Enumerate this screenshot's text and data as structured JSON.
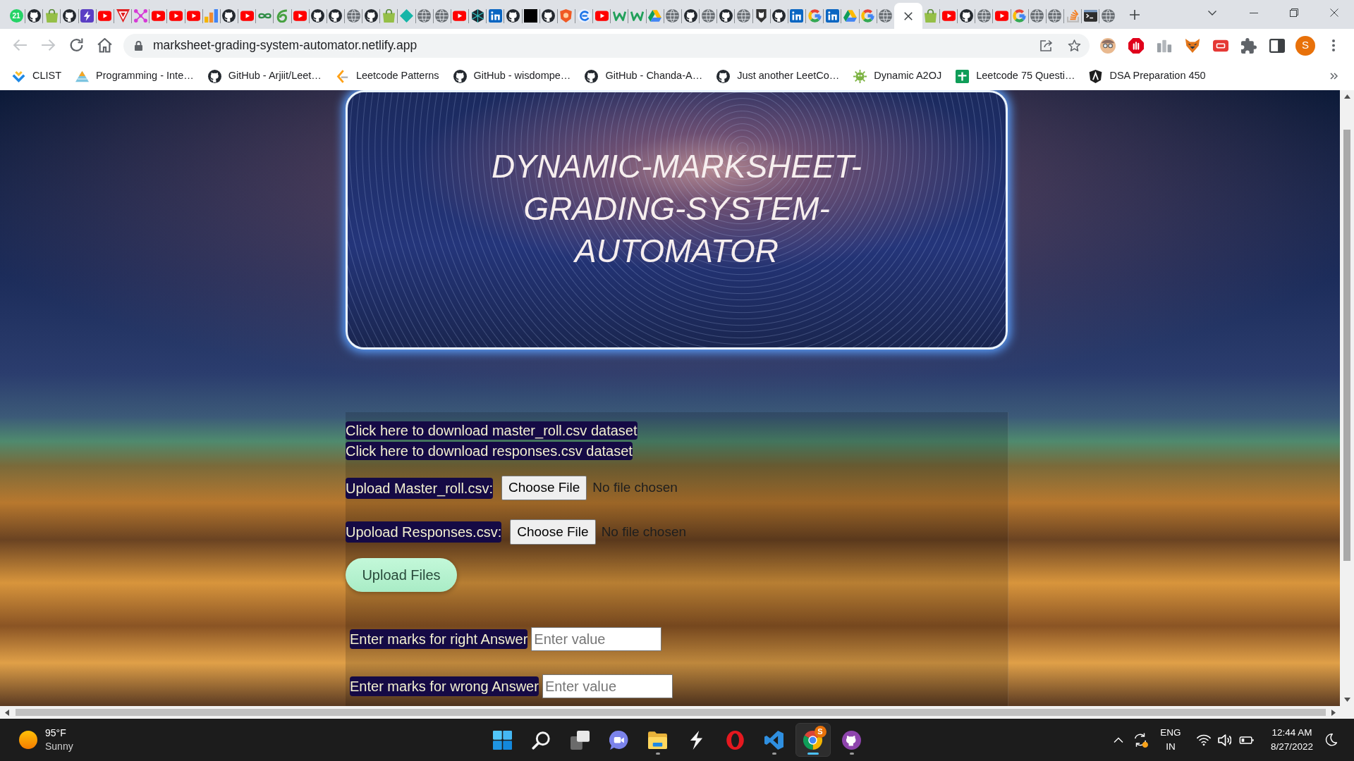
{
  "browser": {
    "tabs": [
      {
        "kind": "chat",
        "badge": "21",
        "selected": false
      },
      {
        "kind": "octocat",
        "selected": false
      },
      {
        "kind": "bag",
        "selected": false
      },
      {
        "kind": "octocat",
        "selected": false
      },
      {
        "kind": "bolt",
        "selected": false
      },
      {
        "kind": "play",
        "selected": false
      },
      {
        "kind": "pennant",
        "selected": false
      },
      {
        "kind": "nodes",
        "selected": false
      },
      {
        "kind": "play",
        "selected": false
      },
      {
        "kind": "play",
        "selected": false
      },
      {
        "kind": "play",
        "selected": false
      },
      {
        "kind": "bars",
        "selected": false
      },
      {
        "kind": "octocat",
        "selected": false
      },
      {
        "kind": "play",
        "selected": false
      },
      {
        "kind": "loops",
        "selected": false
      },
      {
        "kind": "leaf",
        "selected": false
      },
      {
        "kind": "play",
        "selected": false
      },
      {
        "kind": "octocat",
        "selected": false
      },
      {
        "kind": "octocat",
        "selected": false
      },
      {
        "kind": "globe",
        "selected": false
      },
      {
        "kind": "octocat",
        "selected": false
      },
      {
        "kind": "bag",
        "selected": false
      },
      {
        "kind": "diamond",
        "selected": false
      },
      {
        "kind": "globe",
        "selected": false
      },
      {
        "kind": "globe",
        "selected": false
      },
      {
        "kind": "play",
        "selected": false
      },
      {
        "kind": "crystal",
        "selected": false
      },
      {
        "kind": "in-square",
        "selected": false
      },
      {
        "kind": "octocat",
        "selected": false
      },
      {
        "kind": "square",
        "selected": false
      },
      {
        "kind": "octocat",
        "selected": false
      },
      {
        "kind": "orange-shield",
        "selected": false
      },
      {
        "kind": "swirl",
        "selected": false
      },
      {
        "kind": "play",
        "selected": false
      },
      {
        "kind": "zigzag",
        "selected": false
      },
      {
        "kind": "zigzag",
        "selected": false
      },
      {
        "kind": "drive",
        "selected": false
      },
      {
        "kind": "globe",
        "selected": false
      },
      {
        "kind": "octocat",
        "selected": false
      },
      {
        "kind": "globe",
        "selected": false
      },
      {
        "kind": "octocat",
        "selected": false
      },
      {
        "kind": "globe",
        "selected": false
      },
      {
        "kind": "dark-cat",
        "selected": false
      },
      {
        "kind": "octocat",
        "selected": false
      },
      {
        "kind": "in-square",
        "selected": false
      },
      {
        "kind": "g-ring",
        "selected": false
      },
      {
        "kind": "in-square",
        "selected": false
      },
      {
        "kind": "drive",
        "selected": false
      },
      {
        "kind": "g-ring",
        "selected": false
      },
      {
        "kind": "globe",
        "selected": false
      },
      {
        "selected": true
      },
      {
        "kind": "bag",
        "selected": false
      },
      {
        "kind": "play",
        "selected": false
      },
      {
        "kind": "octocat",
        "selected": false
      },
      {
        "kind": "globe",
        "selected": false
      },
      {
        "kind": "play",
        "selected": false
      },
      {
        "kind": "g-ring",
        "selected": false
      },
      {
        "kind": "globe",
        "selected": false
      },
      {
        "kind": "globe",
        "selected": false
      },
      {
        "kind": "stack",
        "selected": false
      },
      {
        "kind": "terminal",
        "selected": false
      },
      {
        "kind": "globe",
        "selected": false
      }
    ],
    "nav_buttons": [
      {
        "kind": "back",
        "disabled": true
      },
      {
        "kind": "forward",
        "disabled": true
      },
      {
        "kind": "reload",
        "disabled": false
      },
      {
        "kind": "home",
        "disabled": false
      }
    ],
    "address_bar": {
      "url": "marksheet-grading-system-automator.netlify.app"
    },
    "profile": {
      "initial": "S"
    },
    "bookmarks": [
      {
        "kind": "chevrons",
        "label": "CLIST"
      },
      {
        "kind": "pyramid",
        "label": "Programming - Inte…"
      },
      {
        "kind": "octocat",
        "label": "GitHub - Arjiit/Leet…"
      },
      {
        "kind": "bracket",
        "label": "Leetcode Patterns"
      },
      {
        "kind": "octocat",
        "label": "GitHub - wisdompe…"
      },
      {
        "kind": "octocat",
        "label": "GitHub - Chanda-A…"
      },
      {
        "kind": "octocat",
        "label": "Just another LeetCo…"
      },
      {
        "kind": "virus",
        "label": "Dynamic A2OJ"
      },
      {
        "kind": "sheet",
        "label": "Leetcode 75 Questi…"
      },
      {
        "kind": "shield",
        "label": "DSA Preparation 450"
      }
    ]
  },
  "page": {
    "title": "DYNAMIC-MARKSHEET-GRADING-SYSTEM-AUTOMATOR",
    "download_links": [
      "Click here to download master_roll.csv dataset",
      "Click here to download responses.csv dataset"
    ],
    "uploads": [
      {
        "label": "Upload Master_roll.csv:",
        "button": "Choose File",
        "status": "No file chosen"
      },
      {
        "label": "Upoload Responses.csv:",
        "button": "Choose File",
        "status": "No file chosen"
      }
    ],
    "submit_button": "Upload Files",
    "marks_fields": [
      {
        "label": "Enter marks for right Answer",
        "placeholder": "Enter value"
      },
      {
        "label": "Enter marks for wrong Answer",
        "placeholder": "Enter value"
      }
    ]
  },
  "taskbar": {
    "weather": {
      "temperature": "95°F",
      "condition": "Sunny"
    },
    "apps": [
      {
        "kind": "tiles",
        "running": false,
        "selected": false
      },
      {
        "kind": "magnifier",
        "running": false,
        "selected": false
      },
      {
        "kind": "window-pair",
        "running": false,
        "selected": false
      },
      {
        "kind": "chat-camera",
        "running": false,
        "selected": false
      },
      {
        "kind": "folder",
        "running": true,
        "selected": false
      },
      {
        "kind": "bolt-mark",
        "running": false,
        "selected": false
      },
      {
        "kind": "red-ring",
        "running": false,
        "selected": false
      },
      {
        "kind": "ribbon",
        "running": true,
        "selected": false
      },
      {
        "kind": "pinwheel",
        "running": true,
        "selected": true,
        "badge": "S"
      },
      {
        "kind": "purple-cat",
        "running": true,
        "selected": false
      }
    ],
    "language": {
      "code": "ENG",
      "region": "IN"
    },
    "clock": {
      "time": "12:44 AM",
      "date": "8/27/2022"
    }
  }
}
